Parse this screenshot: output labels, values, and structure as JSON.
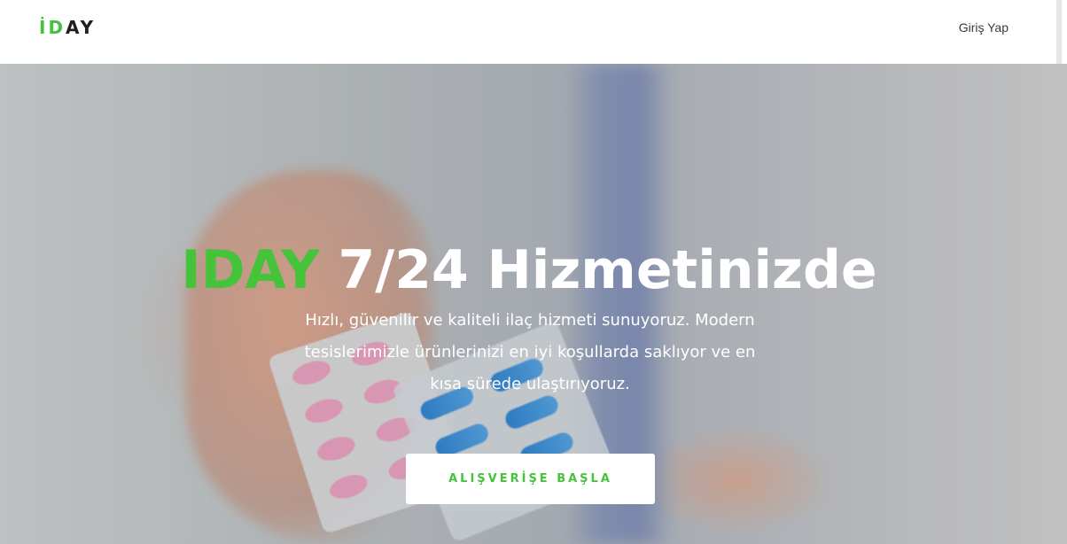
{
  "navbar": {
    "logo_part1": "İD",
    "logo_part2": "AY",
    "login_label": "Giriş Yap"
  },
  "hero": {
    "headline_brand": "IDAY",
    "headline_rest": "7/24 Hizmetinizde",
    "description": "Hızlı, güvenilir ve kaliteli ilaç hizmeti sunuyoruz. Modern tesislerimizle ürünlerinizi en iyi koşullarda saklıyor ve en kısa sürede ulaştırıyoruz.",
    "cta_label": "ALIŞVERİŞE BAŞLA"
  },
  "colors": {
    "brand_green": "#45c33a",
    "text_dark": "#1f1f1f",
    "white": "#ffffff"
  }
}
